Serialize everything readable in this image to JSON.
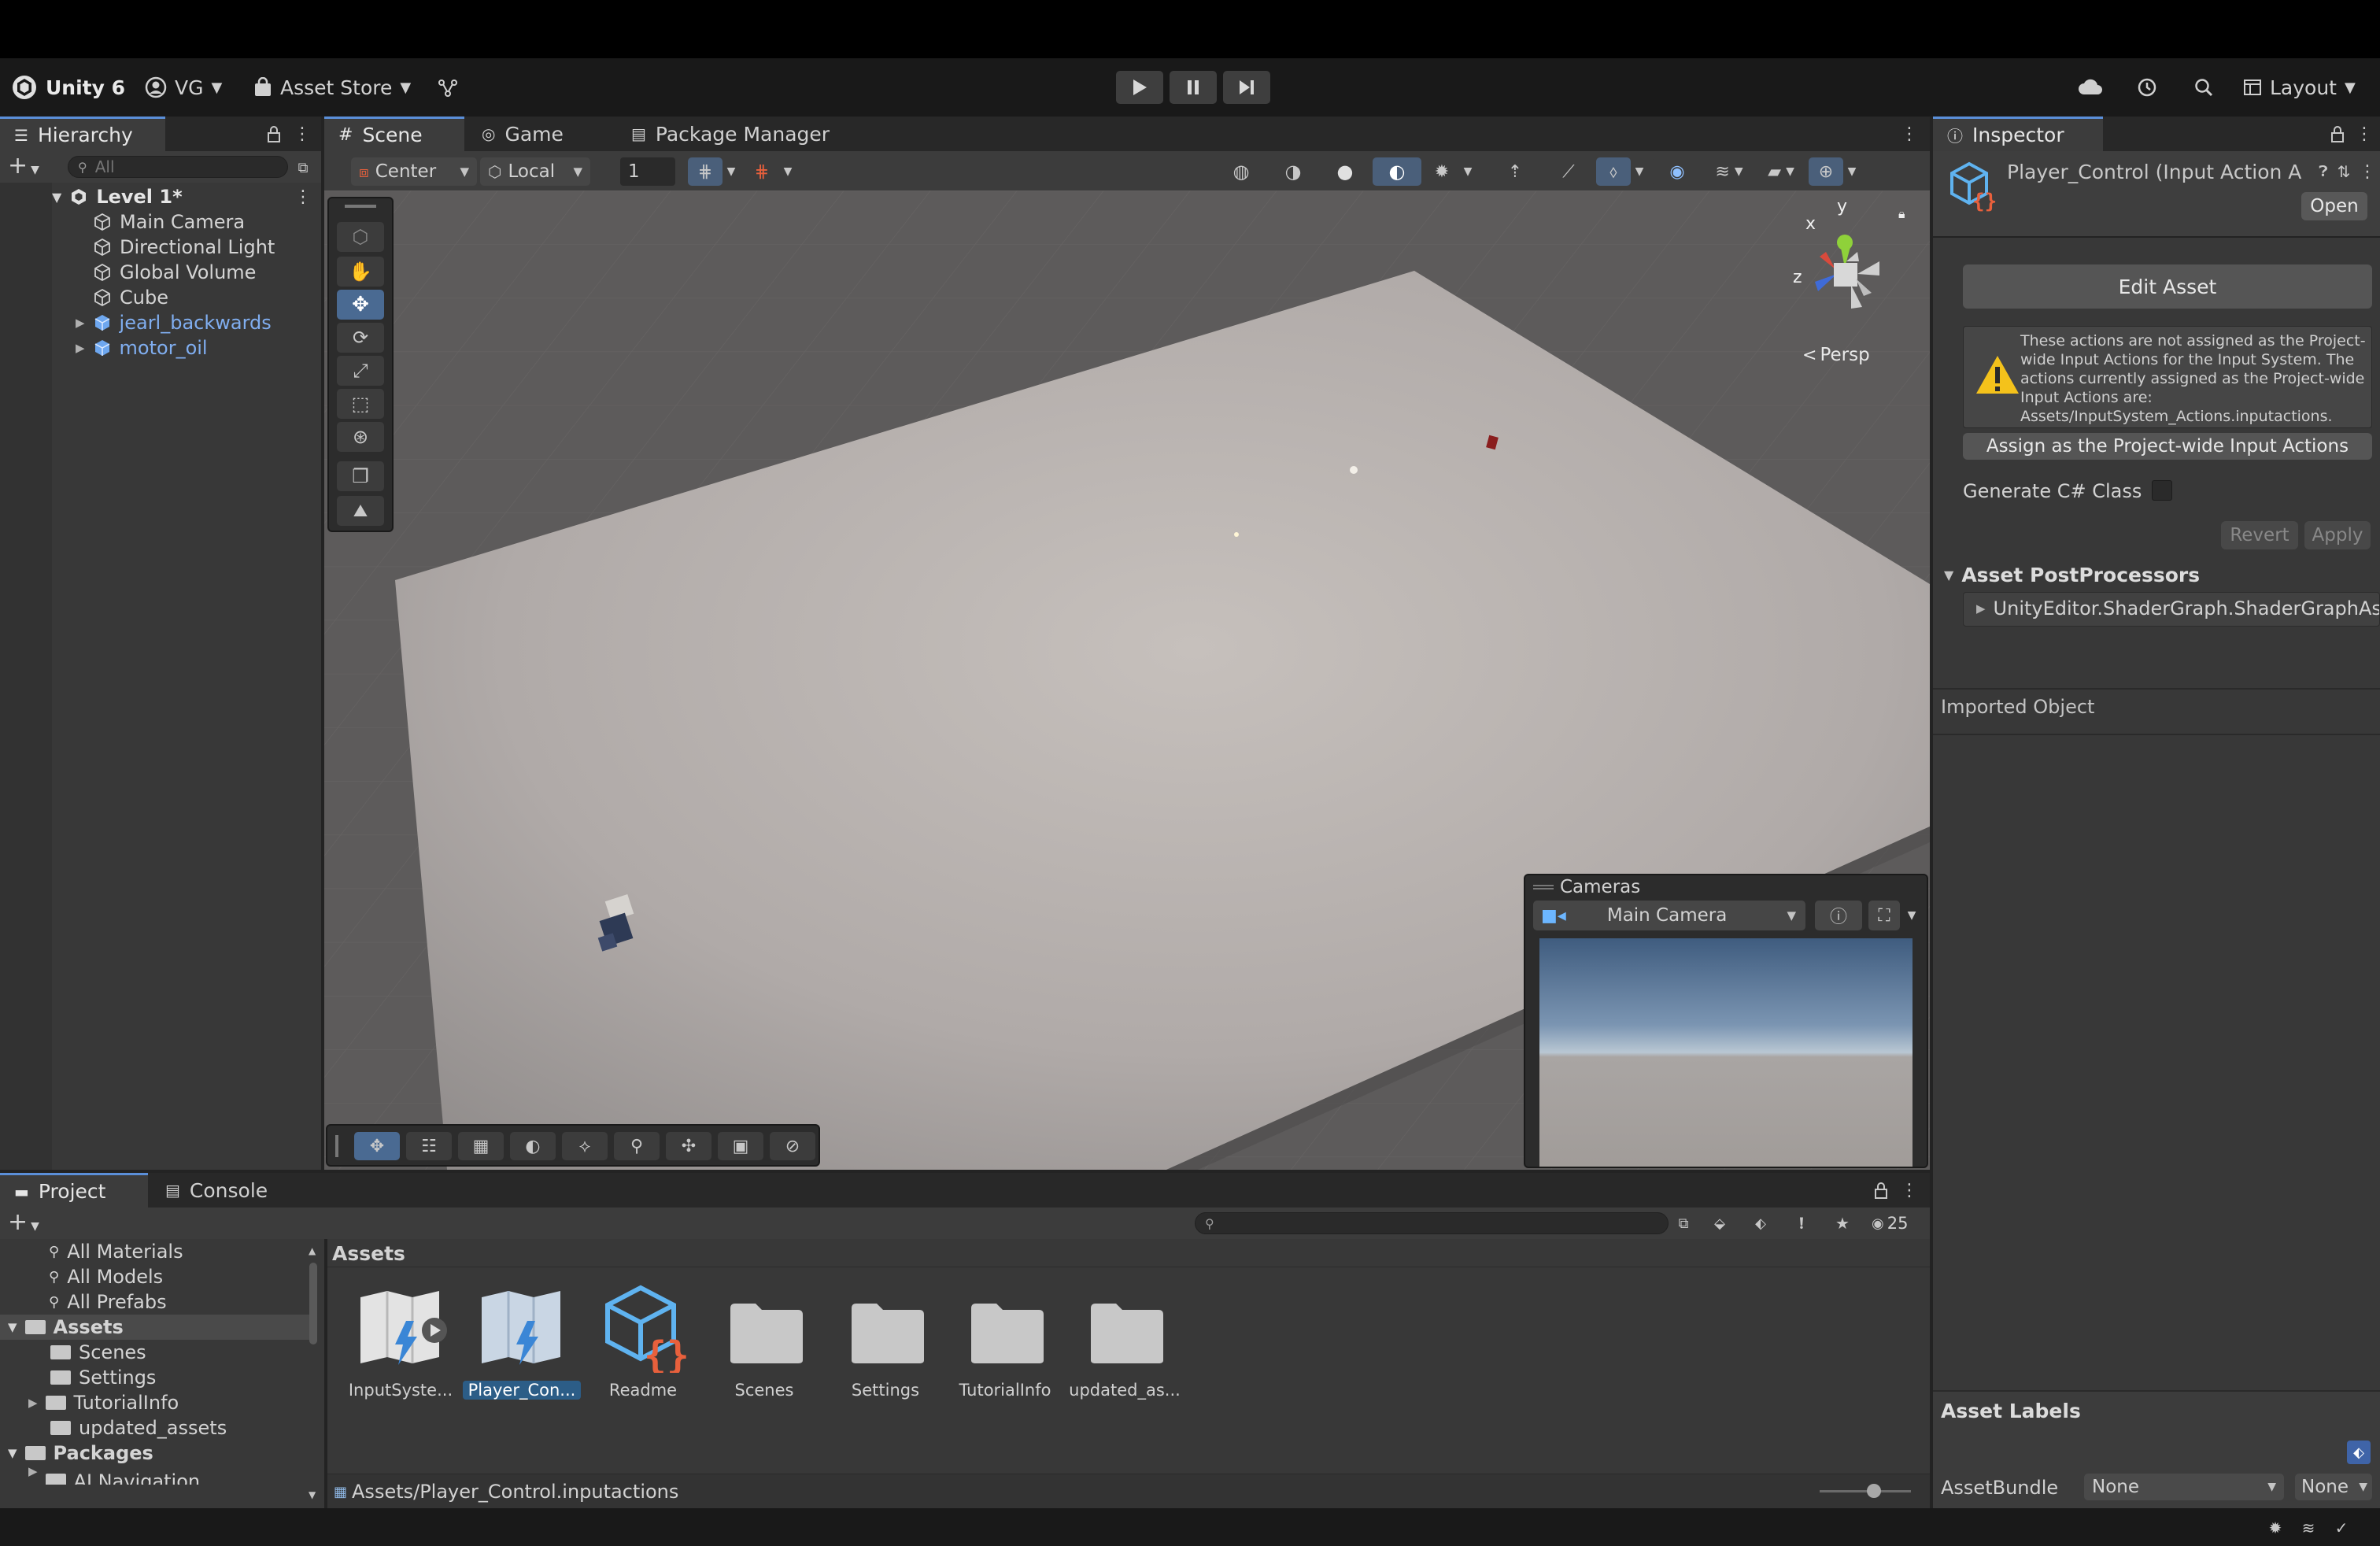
{
  "toolbar": {
    "app_name": "Unity 6",
    "account": "VG",
    "asset_store": "Asset Store",
    "layout": "Layout"
  },
  "hierarchy": {
    "tab": "Hierarchy",
    "search_placeholder": "All",
    "scene_name": "Level 1*",
    "items": [
      {
        "label": "Main Camera"
      },
      {
        "label": "Directional Light"
      },
      {
        "label": "Global Volume"
      },
      {
        "label": "Cube"
      },
      {
        "label": "jearl_backwards"
      },
      {
        "label": "motor_oil"
      }
    ]
  },
  "scene_tabs": {
    "scene": "Scene",
    "game": "Game",
    "package_manager": "Package Manager"
  },
  "scene_toolbar": {
    "pivot": "Center",
    "space": "Local",
    "snap_value": "1"
  },
  "scene_view": {
    "persp_label": "Persp",
    "gizmo_x": "x",
    "gizmo_y": "y",
    "gizmo_z": "z"
  },
  "cameras_overlay": {
    "title": "Cameras",
    "selected": "Main Camera"
  },
  "inspector": {
    "tab": "Inspector",
    "asset_title": "Player_Control (Input Action A",
    "open_button": "Open",
    "edit_asset_button": "Edit Asset",
    "warning_text": "These actions are not assigned as the Project-wide Input Actions for the Input System.  The actions currently assigned as the Project-wide Input Actions are: Assets/InputSystem_Actions.inputactions.",
    "assign_button": "Assign as the Project-wide Input Actions",
    "generate_label": "Generate C# Class",
    "generate_checked": false,
    "revert_button": "Revert",
    "apply_button": "Apply",
    "postprocessors_header": "Asset PostProcessors",
    "postprocessor_item": "UnityEditor.ShaderGraph.ShaderGraphAsse",
    "imported_object": "Imported Object",
    "asset_labels": "Asset Labels",
    "assetbundle_label": "AssetBundle",
    "assetbundle_value": "None",
    "assetbundle_variant": "None"
  },
  "project": {
    "tab_project": "Project",
    "tab_console": "Console",
    "hidden_count": "25",
    "favorites": [
      {
        "label": "All Materials"
      },
      {
        "label": "All Models"
      },
      {
        "label": "All Prefabs"
      }
    ],
    "assets_root": "Assets",
    "asset_folders": [
      {
        "label": "Scenes"
      },
      {
        "label": "Settings"
      },
      {
        "label": "TutorialInfo"
      },
      {
        "label": "updated_assets"
      }
    ],
    "packages_root": "Packages",
    "packages_partial": "AI Navigation",
    "breadcrumb": "Assets",
    "grid_items": [
      {
        "label": "InputSyste..."
      },
      {
        "label": "Player_Con..."
      },
      {
        "label": "Readme"
      },
      {
        "label": "Scenes"
      },
      {
        "label": "Settings"
      },
      {
        "label": "TutorialInfo"
      },
      {
        "label": "updated_as..."
      }
    ],
    "selected_path": "Assets/Player_Control.inputactions"
  },
  "colors": {
    "accent": "#2c5d87",
    "prefab": "#80aef0",
    "warning": "#f4c21b",
    "readme_brace": "#e8603c"
  }
}
